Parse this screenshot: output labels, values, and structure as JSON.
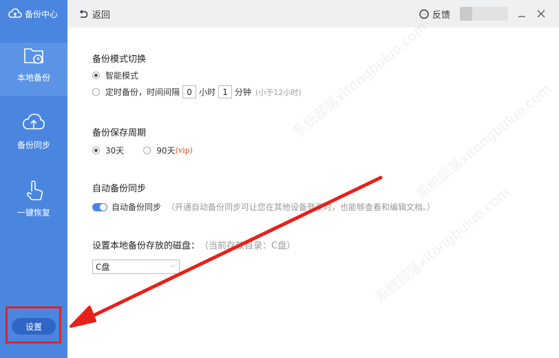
{
  "app": {
    "title": "备份中心"
  },
  "sidebar": {
    "items": [
      {
        "label": "本地备份",
        "icon": "folder-clock-icon"
      },
      {
        "label": "备份同步",
        "icon": "cloud-upload-icon"
      },
      {
        "label": "一键恢复",
        "icon": "hand-pointer-icon"
      }
    ],
    "settings_label": "设置"
  },
  "topbar": {
    "back_label": "返回",
    "feedback_label": "反馈"
  },
  "backup_mode": {
    "title": "备份模式切换",
    "option_smart": "智能模式",
    "option_timed_prefix": "定时备份，时间间隔",
    "hours_value": "0",
    "hours_unit": "小时",
    "minutes_value": "1",
    "minutes_unit": "分钟",
    "hint": "(小于12小时)",
    "selected": "smart"
  },
  "retention": {
    "title": "备份保存周期",
    "option_30": "30天",
    "option_90": "90天",
    "vip_tag": "(vip)",
    "selected": "30"
  },
  "auto_sync": {
    "title": "自动备份同步",
    "toggle_label": "自动备份同步",
    "enabled": true,
    "description": "（开通自动备份同步可让您在其他设备登录时，也能够查看和编辑文档。）"
  },
  "disk": {
    "title": "设置本地备份存放的磁盘：",
    "current": "（当前存放目录：C盘）",
    "selected_value": "C盘"
  },
  "colors": {
    "sidebar": "#4a86e0",
    "settings_button": "#2f65c4",
    "annotation_red": "#e8201a"
  }
}
